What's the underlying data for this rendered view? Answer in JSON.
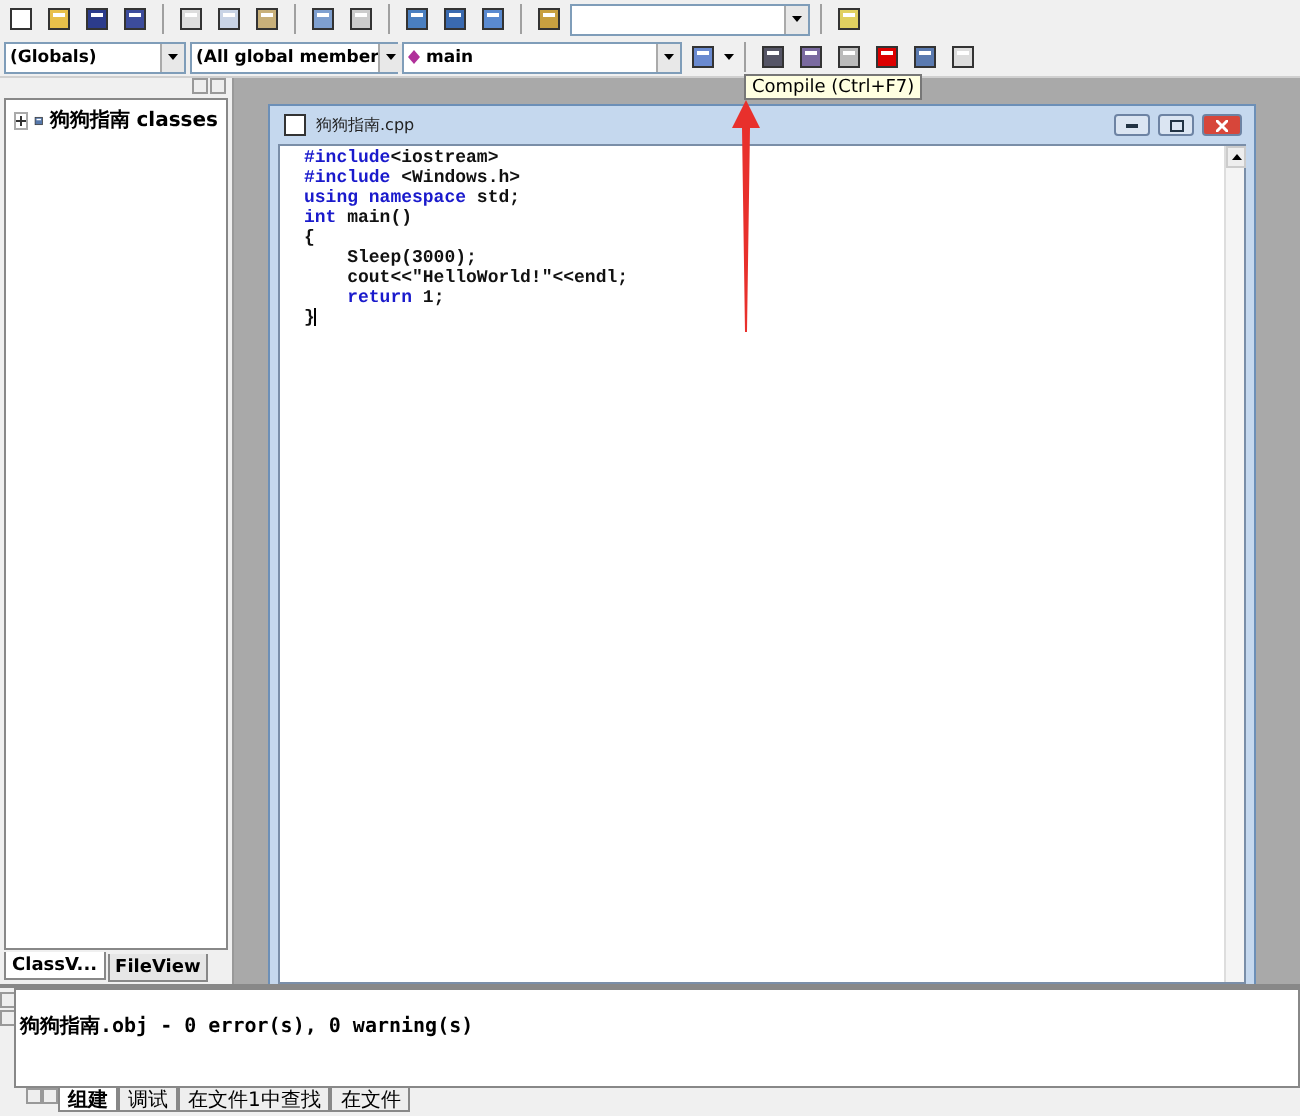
{
  "wizard_bar": {
    "class_combo": "(Globals)",
    "filter_combo": "(All global member",
    "member_combo": "main"
  },
  "tooltip": "Compile (Ctrl+F7)",
  "workspace": {
    "tree": [
      {
        "label": "狗狗指南 classes",
        "expanded": false
      }
    ],
    "tabs": [
      {
        "label": "ClassV...",
        "selected": true
      },
      {
        "label": "FileView",
        "selected": false
      }
    ]
  },
  "editor": {
    "title": "狗狗指南.cpp",
    "lines": [
      [
        {
          "text": "#include",
          "kind": "keyword"
        },
        {
          "text": "<iostream>",
          "kind": "plain"
        }
      ],
      [
        {
          "text": "#include",
          "kind": "keyword"
        },
        {
          "text": " <Windows.h>",
          "kind": "plain"
        }
      ],
      [
        {
          "text": "using namespace",
          "kind": "keyword"
        },
        {
          "text": " std;",
          "kind": "plain"
        }
      ],
      [
        {
          "text": "int",
          "kind": "keyword"
        },
        {
          "text": " main()",
          "kind": "plain"
        }
      ],
      [
        {
          "text": "{",
          "kind": "plain"
        }
      ],
      [
        {
          "text": "    Sleep(3000);",
          "kind": "plain"
        }
      ],
      [
        {
          "text": "    cout<<\"HelloWorld!\"<<endl;",
          "kind": "plain"
        }
      ],
      [
        {
          "text": "    return",
          "kind": "keyword"
        },
        {
          "text": " 1;",
          "kind": "plain"
        }
      ],
      [
        {
          "text": "}",
          "kind": "plain"
        }
      ]
    ]
  },
  "output": {
    "text": "狗狗指南.obj - 0 error(s), 0 warning(s)",
    "tabs": [
      {
        "label": "组建",
        "selected": true
      },
      {
        "label": "调试",
        "selected": false
      },
      {
        "label": "在文件1中查找",
        "selected": false
      },
      {
        "label": "在文件",
        "selected": false
      }
    ]
  }
}
